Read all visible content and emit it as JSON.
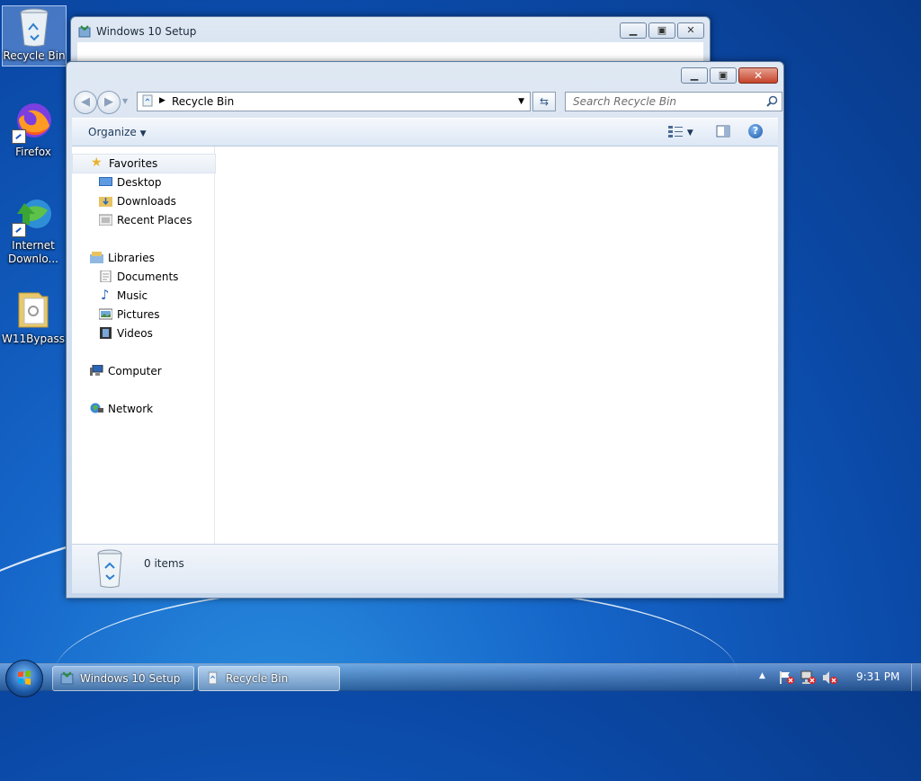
{
  "desktop": {
    "icons": [
      {
        "label": "Recycle Bin",
        "icon": "recycle-bin-icon"
      },
      {
        "label": "Firefox",
        "icon": "firefox-icon"
      },
      {
        "label": "Internet Downlo...",
        "line1": "Internet",
        "line2": "Downlo...",
        "icon": "internet-download-manager-icon"
      },
      {
        "label": "W11Bypass",
        "icon": "folder-icon"
      }
    ]
  },
  "setup_window": {
    "title": "Windows 10 Setup",
    "icon": "setup-icon"
  },
  "explorer": {
    "address": "Recycle Bin",
    "search_placeholder": "Search Recycle Bin",
    "toolbar": {
      "organize_label": "Organize"
    },
    "nav": {
      "favorites": {
        "label": "Favorites",
        "items": [
          "Desktop",
          "Downloads",
          "Recent Places"
        ]
      },
      "libraries": {
        "label": "Libraries",
        "items": [
          "Documents",
          "Music",
          "Pictures",
          "Videos"
        ]
      },
      "computer": "Computer",
      "network": "Network"
    },
    "status": {
      "items_count": "0 items"
    }
  },
  "taskbar": {
    "tasks": [
      {
        "label": "Windows 10 Setup",
        "icon": "setup-icon"
      },
      {
        "label": "Recycle Bin",
        "icon": "recycle-bin-icon"
      }
    ],
    "clock": "9:31 PM"
  },
  "colors": {
    "desktop": "#0b4aa8",
    "close_button": "#c5432a",
    "accent": "#1e395b"
  }
}
